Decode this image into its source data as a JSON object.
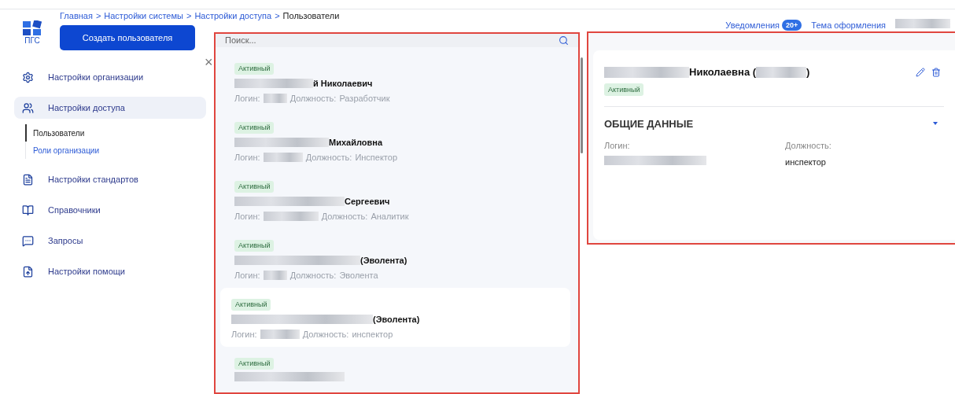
{
  "breadcrumbs": [
    {
      "label": "Главная",
      "current": false
    },
    {
      "label": "Настройки системы",
      "current": false
    },
    {
      "label": "Настройки доступа",
      "current": false
    },
    {
      "label": "Пользователи",
      "current": true
    }
  ],
  "separator": ">",
  "logo_text": "ПГС",
  "create_button": "Создать пользователя",
  "close_icon": "×",
  "sidebar": {
    "items": [
      {
        "label": "Настройки организации",
        "selected": false
      },
      {
        "label": "Настройки доступа",
        "selected": true,
        "children": [
          {
            "label": "Пользователи",
            "selected": true
          },
          {
            "label": "Роли организации",
            "selected": false
          }
        ]
      },
      {
        "label": "Настройки стандартов",
        "selected": false
      },
      {
        "label": "Справочники",
        "selected": false
      },
      {
        "label": "Запросы",
        "selected": false
      },
      {
        "label": "Настройки помощи",
        "selected": false
      }
    ]
  },
  "search": {
    "placeholder": "Поиск..."
  },
  "users": [
    {
      "status": "Активный",
      "name_visible": "й Николаевич",
      "login_label": "Логин:",
      "position_label": "Должность:",
      "position": "Разработчик",
      "selected": false
    },
    {
      "status": "Активный",
      "name_visible": "Михайловна",
      "login_label": "Логин:",
      "position_label": "Должность:",
      "position": "Инспектор",
      "selected": false
    },
    {
      "status": "Активный",
      "name_visible": "Сергеевич",
      "login_label": "Логин:",
      "position_label": "Должность:",
      "position": "Аналитик",
      "selected": false
    },
    {
      "status": "Активный",
      "name_visible": "(Эволента)",
      "login_label": "Логин:",
      "position_label": "Должность:",
      "position": "Эволента",
      "selected": false
    },
    {
      "status": "Активный",
      "name_visible": "(Эволента)",
      "login_label": "Логин:",
      "position_label": "Должность:",
      "position": "инспектор",
      "selected": true
    },
    {
      "status": "Активный",
      "selected": false
    }
  ],
  "header": {
    "notifications": "Уведомления",
    "notifications_count": "20+",
    "theme": "Тема оформления"
  },
  "detail": {
    "name_visible": "Николаевна (",
    "name_end": ")",
    "status": "Активный",
    "section": "ОБЩИЕ ДАННЫЕ",
    "login_label": "Логин:",
    "position_label": "Должность:",
    "position": "инспектор"
  }
}
